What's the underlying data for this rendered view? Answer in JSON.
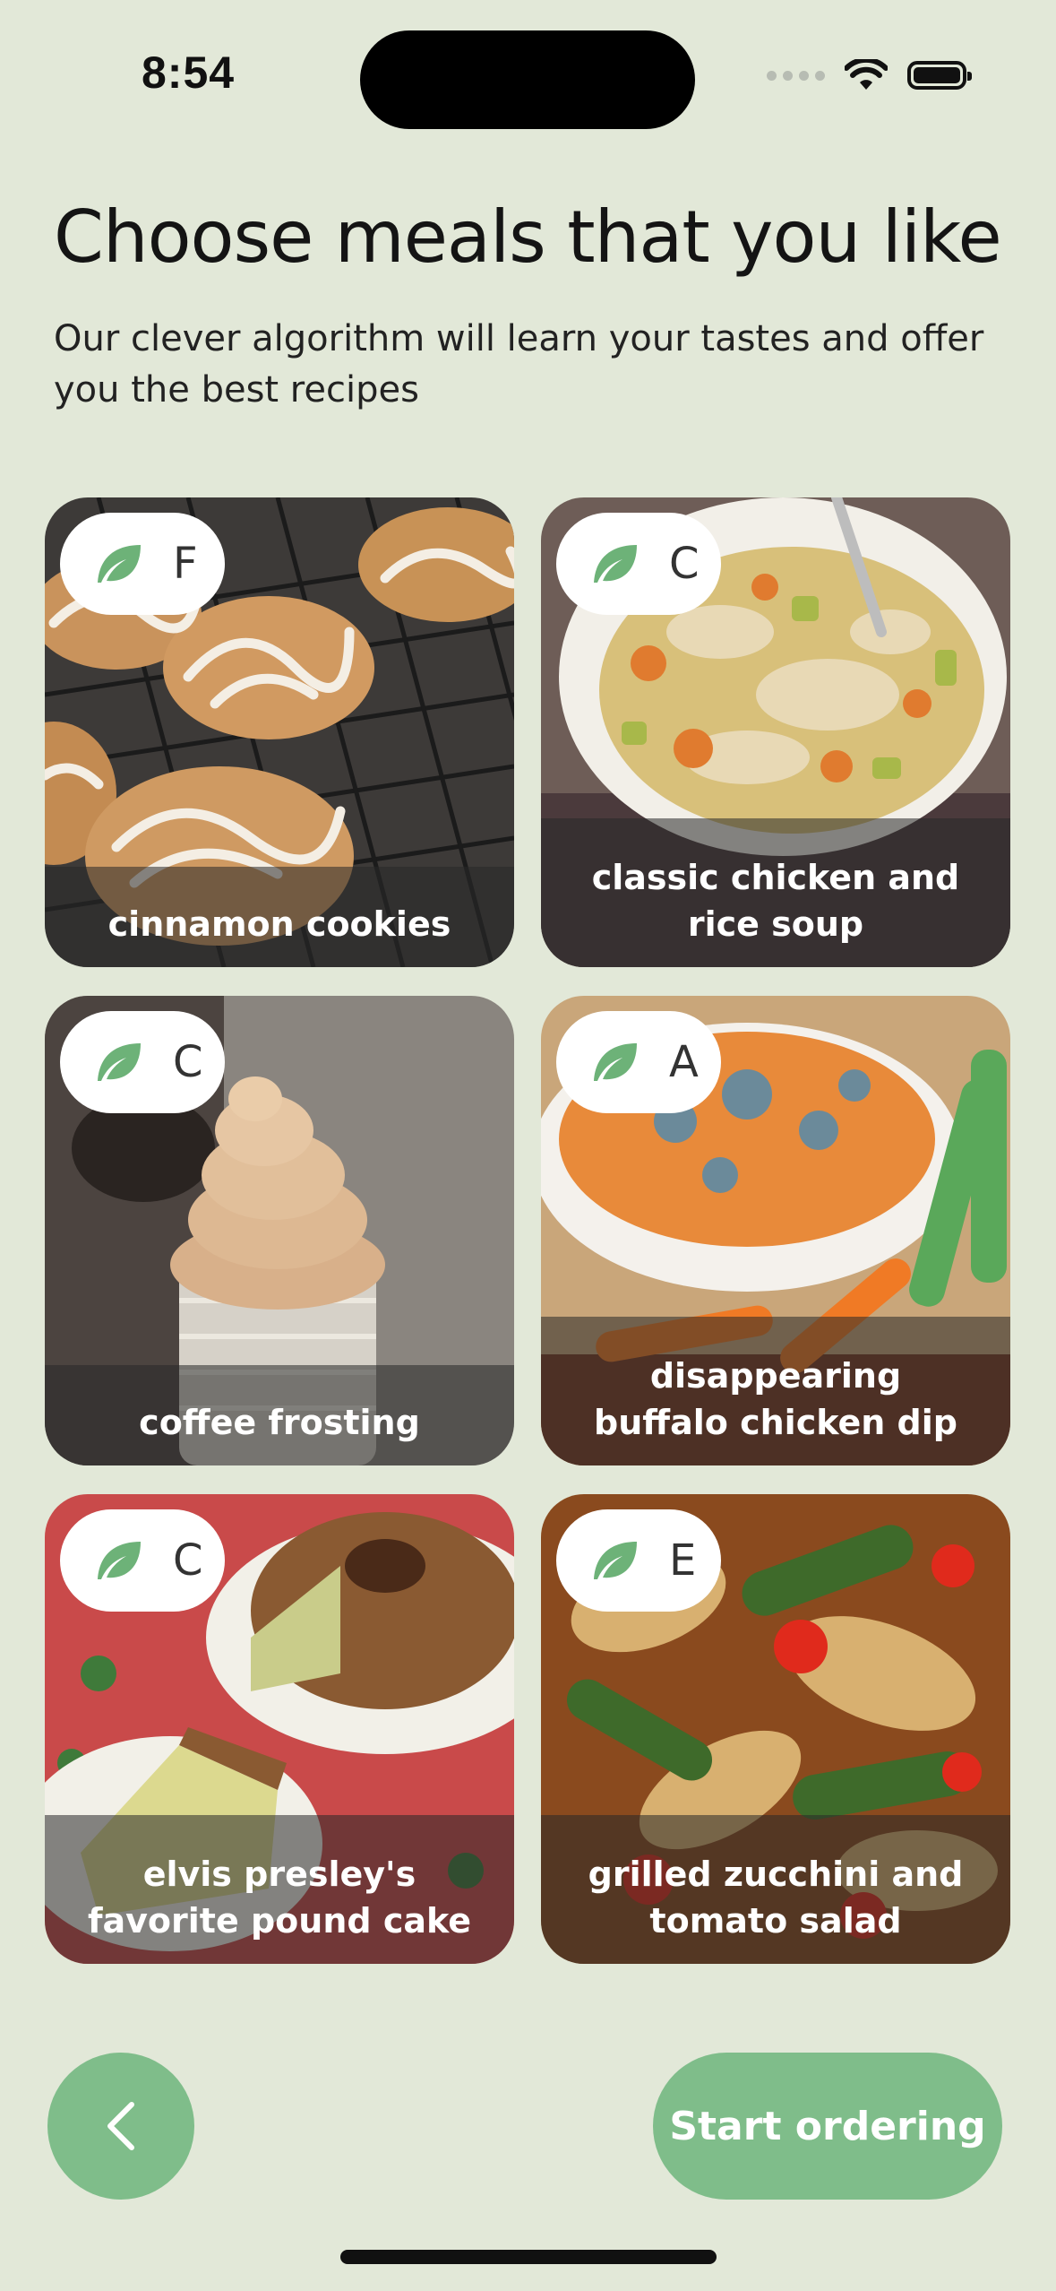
{
  "status_bar": {
    "time": "8:54"
  },
  "header": {
    "title": "Choose meals that you like",
    "subtitle": "Our clever algorithm will learn your tastes and offer you the best recipes"
  },
  "meals": [
    {
      "name": "cinnamon cookies",
      "grade": "F",
      "icon": "leaf-icon"
    },
    {
      "name": "classic chicken and rice soup",
      "grade": "C",
      "icon": "leaf-icon"
    },
    {
      "name": "coffee frosting",
      "grade": "C",
      "icon": "leaf-icon"
    },
    {
      "name": "disappearing buffalo chicken dip",
      "grade": "A",
      "icon": "leaf-icon"
    },
    {
      "name": "elvis presley's favorite pound cake",
      "grade": "C",
      "icon": "leaf-icon"
    },
    {
      "name": "grilled zucchini and tomato salad",
      "grade": "E",
      "icon": "leaf-icon"
    }
  ],
  "buttons": {
    "back_icon": "chevron-left-icon",
    "start_label": "Start ordering"
  },
  "colors": {
    "background": "#e2e8d8",
    "accent": "#7fbd8a",
    "leaf": "#6db278"
  }
}
